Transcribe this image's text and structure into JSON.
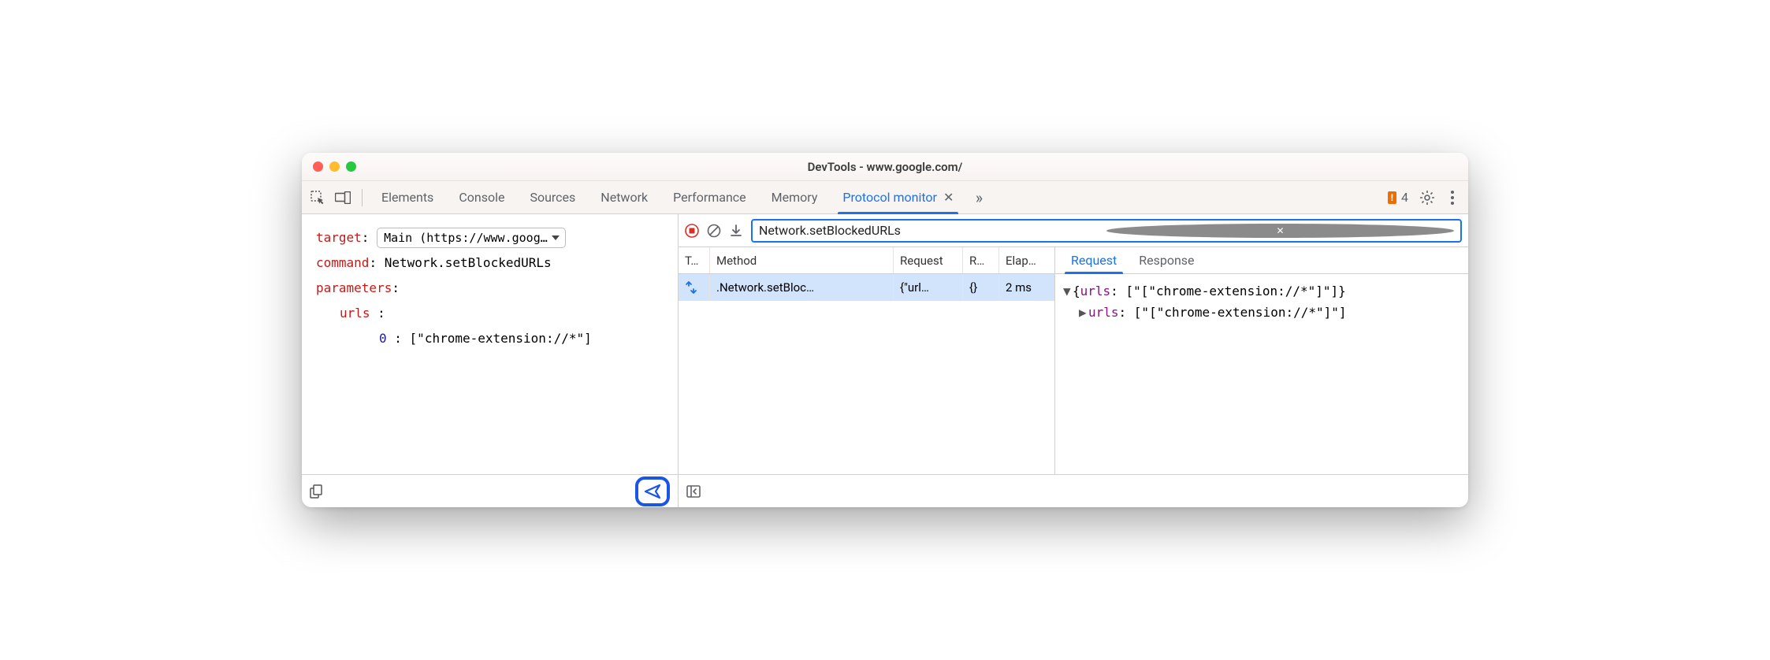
{
  "window": {
    "title": "DevTools - www.google.com/"
  },
  "tabs": {
    "items": [
      "Elements",
      "Console",
      "Sources",
      "Network",
      "Performance",
      "Memory",
      "Protocol monitor"
    ],
    "activeIndex": 6
  },
  "issues": {
    "count": "4"
  },
  "editor": {
    "target_label": "target",
    "target_value": "Main (https://www.goog…",
    "command_label": "command",
    "command_value": "Network.setBlockedURLs",
    "parameters_label": "parameters",
    "param_key": "urls",
    "index": "0",
    "index_value": "[\"chrome-extension://*\"]"
  },
  "filter": {
    "text": "Network.setBlockedURLs"
  },
  "grid": {
    "headers": {
      "type": "T…",
      "method": "Method",
      "request": "Request",
      "response": "R…",
      "elapsed": "Elap…"
    },
    "row": {
      "method": "Network.setBloc…",
      "request": "{\"url…",
      "response": "{}",
      "elapsed": "2 ms"
    }
  },
  "detail": {
    "tabs": {
      "request": "Request",
      "response": "Response"
    },
    "line1_key": "urls",
    "line1_val": "[\"[\"chrome-extension://*\"]\"]",
    "line2_key": "urls",
    "line2_val": "[\"[\"chrome-extension://*\"]\"]"
  },
  "colors": {
    "red": "#ff5f57",
    "yellow": "#febc2e",
    "green": "#28c840"
  }
}
